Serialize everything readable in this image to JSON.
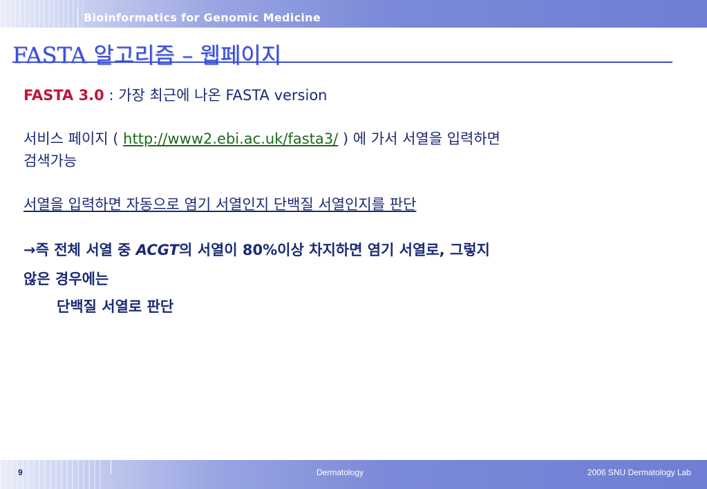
{
  "header": {
    "title": "Bioinformatics for Genomic Medicine"
  },
  "slide": {
    "title": "FASTA 알고리즘 – 웹페이지",
    "line1": {
      "label": "FASTA 3.0",
      "sep": " : ",
      "text_ko": "가장 최근에 나온 ",
      "text_en": "FASTA version"
    },
    "line2": {
      "pre": "서비스 페이지 ",
      "paren_open": "( ",
      "url": "http://www2.ebi.ac.uk/fasta3/",
      "paren_close": " )",
      "post": " 에 가서 서열을 입력하면"
    },
    "line3": "검색가능",
    "line4": "서열을 입력하면 자동으로 염기 서열인지 단백질 서열인지를 판단",
    "line5": {
      "arrow": "→",
      "a": "즉 전체 서열 중 ",
      "acgt": "ACGT",
      "b": "의 서열이 ",
      "pct": "80%",
      "c": "이상 차지하면 염기 서열로, 그렇지"
    },
    "line6": "않은 경우에는",
    "line7": "단백질 서열로 판단"
  },
  "footer": {
    "page": "9",
    "center": "Dermatology",
    "right": "2006 SNU Dermatology Lab"
  }
}
